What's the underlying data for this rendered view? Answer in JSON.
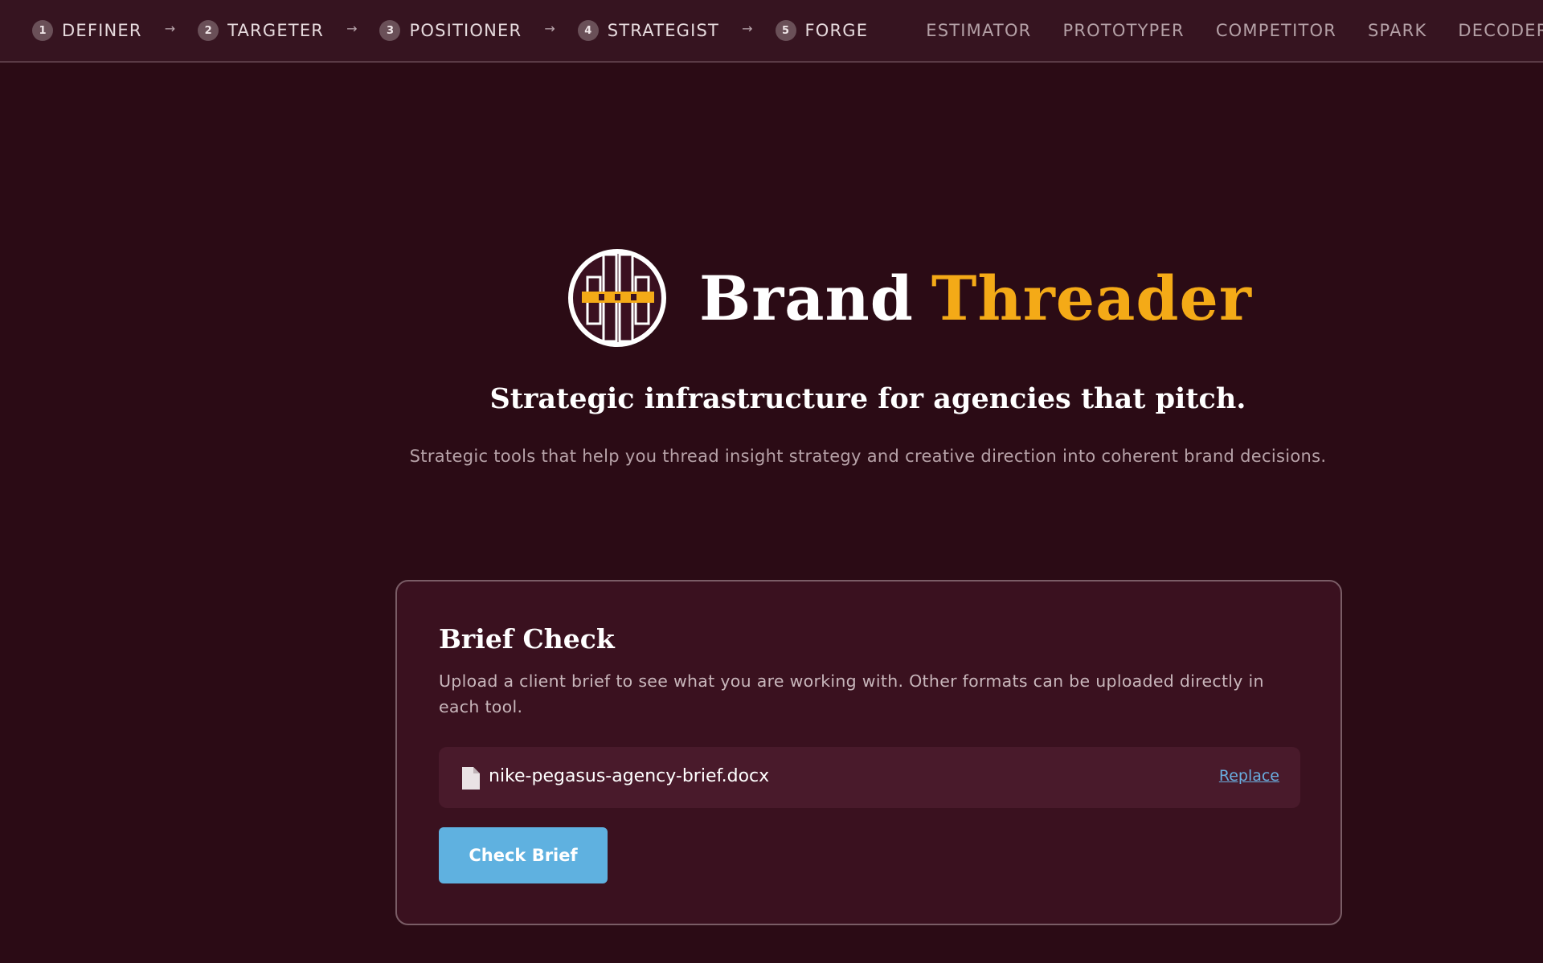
{
  "nav": {
    "steps": [
      {
        "num": "1",
        "label": "DEFINER"
      },
      {
        "num": "2",
        "label": "TARGETER"
      },
      {
        "num": "3",
        "label": "POSITIONER"
      },
      {
        "num": "4",
        "label": "STRATEGIST"
      },
      {
        "num": "5",
        "label": "FORGE"
      }
    ],
    "arrow": "→",
    "tools": [
      "ESTIMATOR",
      "PROTOTYPER",
      "COMPETITOR",
      "SPARK",
      "DECODER"
    ]
  },
  "hero": {
    "brand_word1": "Brand",
    "brand_word2": "Threader",
    "tagline": "Strategic infrastructure for agencies that pitch.",
    "subline": "Strategic tools that help you thread insight strategy and creative direction into coherent brand decisions."
  },
  "brief_check": {
    "title": "Brief Check",
    "description": "Upload a client brief to see what you are working with. Other formats can be uploaded directly in each tool.",
    "file_name": "nike-pegasus-agency-brief.docx",
    "replace_label": "Replace",
    "button_label": "Check Brief"
  },
  "colors": {
    "background": "#2b0b15",
    "accent": "#f4aa17",
    "button": "#5fb1e0",
    "link": "#6aaee0"
  },
  "icons": {
    "logo": "brand-threader-logo-icon",
    "file": "document-icon"
  }
}
